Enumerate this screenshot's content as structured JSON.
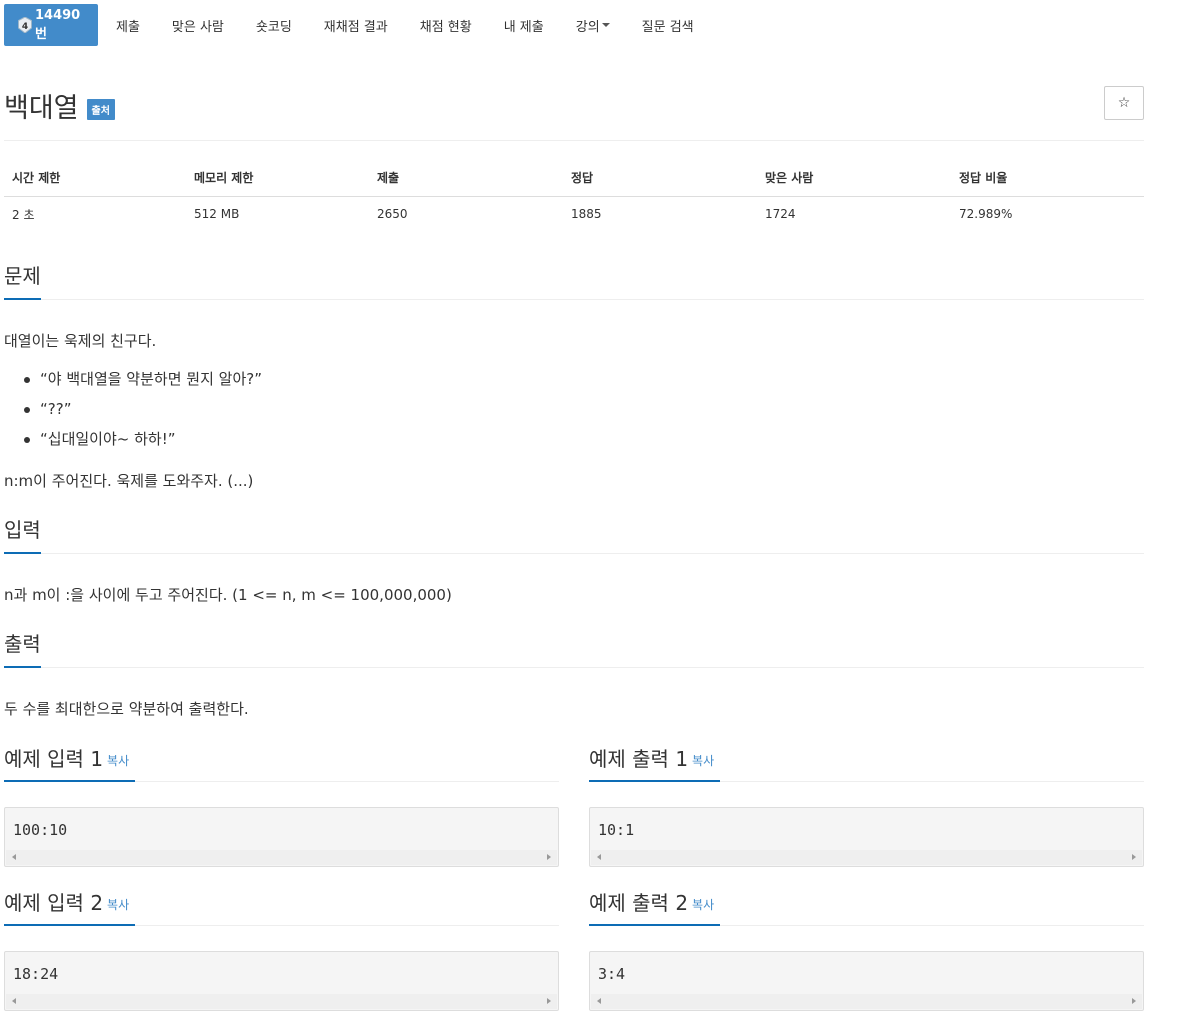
{
  "nav": {
    "problem_id": "14490번",
    "items": [
      "제출",
      "맞은 사람",
      "숏코딩",
      "재채점 결과",
      "채점 현황",
      "내 제출",
      "강의",
      "질문 검색"
    ]
  },
  "problem": {
    "title": "백대열",
    "source_badge": "출처",
    "star": "☆"
  },
  "info": {
    "headers": [
      "시간 제한",
      "메모리 제한",
      "제출",
      "정답",
      "맞은 사람",
      "정답 비율"
    ],
    "values": [
      "2 초",
      "512 MB",
      "2650",
      "1885",
      "1724",
      "72.989%"
    ]
  },
  "sections": {
    "problem_head": "문제",
    "problem_intro": "대열이는 욱제의 친구다.",
    "bullets": [
      "“야 백대열을 약분하면 뭔지 알아?”",
      "“??”",
      "“십대일이야~ 하하!”"
    ],
    "problem_outro": "n:m이 주어진다. 욱제를 도와주자. (...)",
    "input_head": "입력",
    "input_text": "n과 m이 :을 사이에 두고 주어진다. (1 <= n, m <= 100,000,000)",
    "output_head": "출력",
    "output_text": "두 수를 최대한으로 약분하여 출력한다."
  },
  "samples": {
    "copy_label": "복사",
    "in1_title": "예제 입력 1",
    "out1_title": "예제 출력 1",
    "in2_title": "예제 입력 2",
    "out2_title": "예제 출력 2",
    "in1": "100:10",
    "out1": "10:1",
    "in2": "18:24",
    "out2": "3:4"
  },
  "colors": {
    "accent": "#428bca",
    "section_underline": "#0d6cb5"
  }
}
